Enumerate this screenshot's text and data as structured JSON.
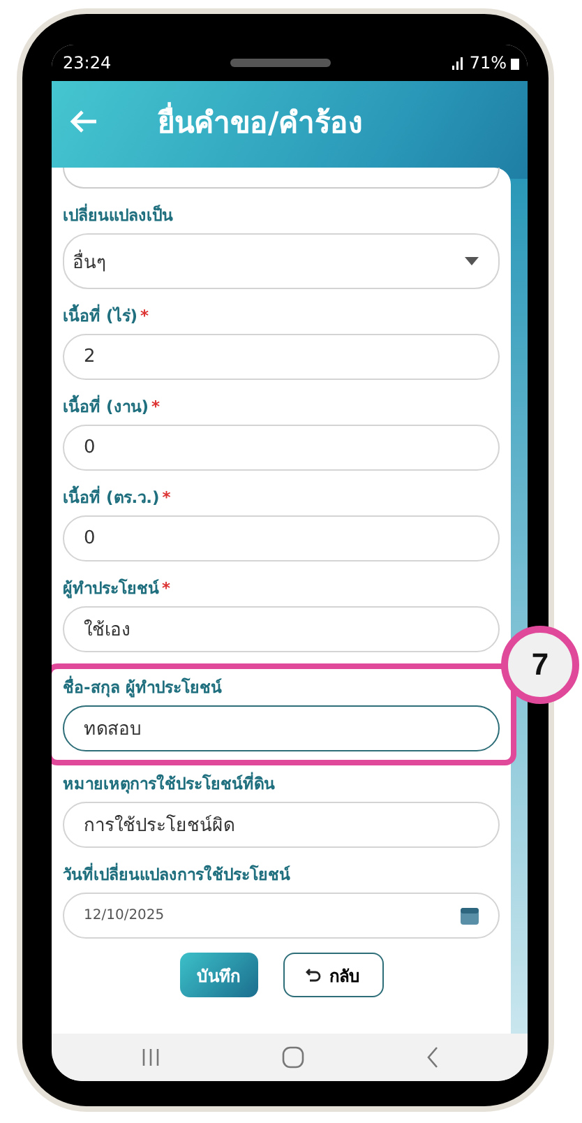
{
  "status_bar": {
    "time": "23:24",
    "battery": "71%"
  },
  "header": {
    "title": "ยื่นคำขอ/คำร้อง"
  },
  "fields": [
    {
      "kind": "select",
      "label": "เปลี่ยนแปลงเป็น",
      "value": "อื่นๆ",
      "highlighted": false
    },
    {
      "kind": "text",
      "label": "เนื้อที่ (ไร่)",
      "required_mark": "*",
      "value": "2",
      "highlighted": false
    },
    {
      "kind": "text",
      "label": "เนื้อที่ (งาน)",
      "required_mark": "*",
      "value": "0",
      "highlighted": false
    },
    {
      "kind": "text",
      "label": "เนื้อที่ (ตร.ว.)",
      "required_mark": "*",
      "value": "0",
      "highlighted": false
    },
    {
      "kind": "text",
      "label": "ผู้ทำประโยชน์",
      "required_mark": "*",
      "value": "ใช้เอง",
      "highlighted": false
    },
    {
      "kind": "text",
      "label": "ชื่อ-สกุล ผู้ทำประโยชน์",
      "value": "ทดสอบ",
      "highlighted": true
    },
    {
      "kind": "text",
      "label": "หมายเหตุการใช้ประโยชน์ที่ดิน",
      "value": "การใช้ประโยชน์ผิด",
      "highlighted": false
    },
    {
      "kind": "date",
      "label": "วันที่เปลี่ยนแปลงการใช้ประโยชน์",
      "value": "12/10/2025",
      "highlighted": false
    }
  ],
  "buttons": {
    "save": "บันทึก",
    "back": "กลับ"
  },
  "callout": {
    "number": "7"
  }
}
